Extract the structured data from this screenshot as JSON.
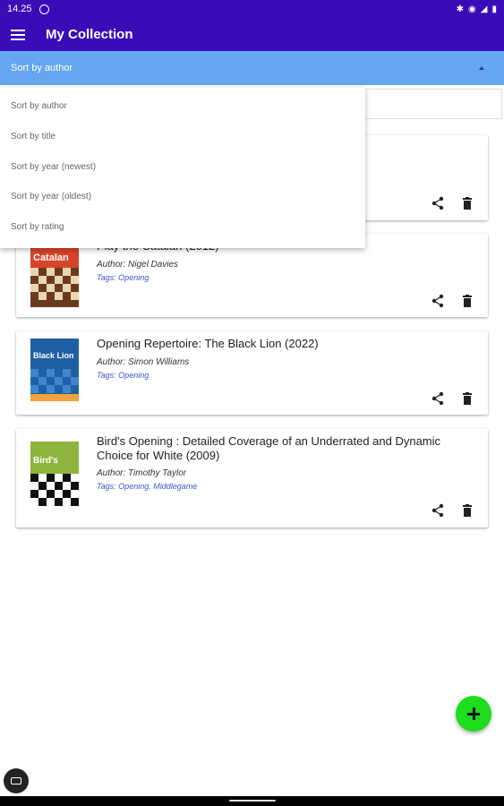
{
  "status_bar": {
    "time": "14.25",
    "icons": [
      "bluetooth-icon",
      "eye-icon",
      "signal-icon",
      "battery-icon"
    ]
  },
  "app_bar": {
    "title": "My Collection"
  },
  "sort": {
    "selected": "Sort by author",
    "options": [
      "Sort by author",
      "Sort by title",
      "Sort by year (newest)",
      "Sort by year (oldest)",
      "Sort by rating"
    ]
  },
  "books": [
    {
      "title": "Play the Catalan (2012)",
      "author": "Author: Nigel Davies",
      "tags": "Tags: Opening",
      "cover_text": "Catalan",
      "cover_color": "#d8442a"
    },
    {
      "title": "Opening Repertoire: The Black Lion (2022)",
      "author": "Author: Simon Williams",
      "tags": "Tags: Opening",
      "cover_text": "Black Lion",
      "cover_color": "#1f5fa3"
    },
    {
      "title": "Bird's Opening : Detailed Coverage of an Underrated and Dynamic Choice for White (2009)",
      "author": "Author: Timothy Taylor",
      "tags": "Tags: Opening, Middlegame",
      "cover_text": "Bird's",
      "cover_color": "#8db53d"
    }
  ],
  "colors": {
    "primary": "#3a0cb8",
    "sort_bar": "#64a6ef",
    "fab": "#1ddd1d",
    "tags": "#3a55cc"
  }
}
